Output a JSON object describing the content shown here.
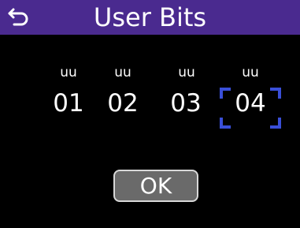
{
  "header": {
    "title": "User Bits",
    "back_icon": "back-arrow-icon"
  },
  "user_bits": [
    {
      "label": "uu",
      "value": "01",
      "selected": false
    },
    {
      "label": "uu",
      "value": "02",
      "selected": false
    },
    {
      "label": "uu",
      "value": "03",
      "selected": false
    },
    {
      "label": "uu",
      "value": "04",
      "selected": true
    }
  ],
  "ok_label": "OK",
  "colors": {
    "title_bar": "#4a2a8f",
    "selection": "#3a4fd8",
    "background": "#000000",
    "ok_button": "#6a6a6a"
  }
}
